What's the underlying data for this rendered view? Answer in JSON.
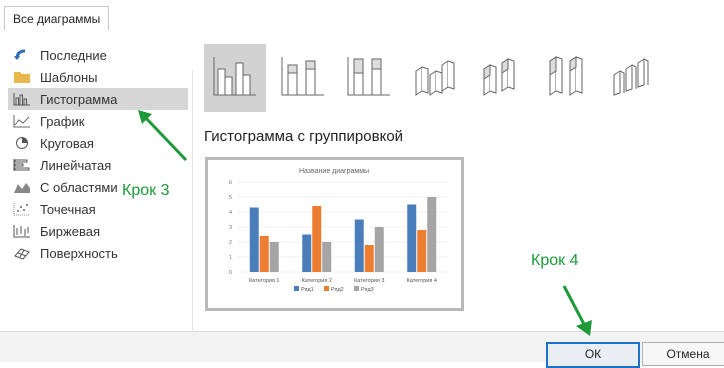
{
  "header": {
    "tab_label": "Все диаграммы"
  },
  "sidebar": {
    "items": [
      {
        "label": "Последние",
        "icon": "recent-icon"
      },
      {
        "label": "Шаблоны",
        "icon": "templates-folder-icon"
      },
      {
        "label": "Гистограмма",
        "icon": "column-chart-icon",
        "selected": true
      },
      {
        "label": "График",
        "icon": "line-chart-icon"
      },
      {
        "label": "Круговая",
        "icon": "pie-chart-icon"
      },
      {
        "label": "Линейчатая",
        "icon": "bar-chart-icon"
      },
      {
        "label": "С областями",
        "icon": "area-chart-icon"
      },
      {
        "label": "Точечная",
        "icon": "scatter-chart-icon"
      },
      {
        "label": "Биржевая",
        "icon": "stock-chart-icon"
      },
      {
        "label": "Поверхность",
        "icon": "surface-chart-icon"
      }
    ]
  },
  "chart_types": {
    "selected_index": 0,
    "items": [
      {
        "icon": "clustered-column-icon",
        "selected": true
      },
      {
        "icon": "stacked-column-icon"
      },
      {
        "icon": "stacked-100-column-icon"
      },
      {
        "icon": "3d-clustered-column-icon"
      },
      {
        "icon": "3d-stacked-column-icon"
      },
      {
        "icon": "3d-stacked-100-column-icon"
      },
      {
        "icon": "3d-column-icon"
      }
    ]
  },
  "preview": {
    "heading": "Гистограмма с группировкой"
  },
  "chart_data": {
    "type": "bar",
    "title": "Название диаграммы",
    "categories": [
      "Категория 1",
      "Категория 2",
      "Категория 3",
      "Категория 4"
    ],
    "series": [
      {
        "name": "Ряд1",
        "values": [
          4.3,
          2.5,
          3.5,
          4.5
        ],
        "color": "#4a7ebb"
      },
      {
        "name": "Ряд2",
        "values": [
          2.4,
          4.4,
          1.8,
          2.8
        ],
        "color": "#ed7d31"
      },
      {
        "name": "Ряд3",
        "values": [
          2,
          2,
          3,
          5
        ],
        "color": "#a5a5a5"
      }
    ],
    "ylim": [
      0,
      6
    ],
    "yticks": [
      "0",
      "1",
      "2",
      "3",
      "4",
      "5",
      "6"
    ],
    "legend": "bottom",
    "grid": true
  },
  "annotations": {
    "step3": "Крок 3",
    "step4": "Крок 4",
    "color": "#1f9a3a"
  },
  "footer": {
    "ok_label": "ОК",
    "cancel_label": "Отмена"
  }
}
